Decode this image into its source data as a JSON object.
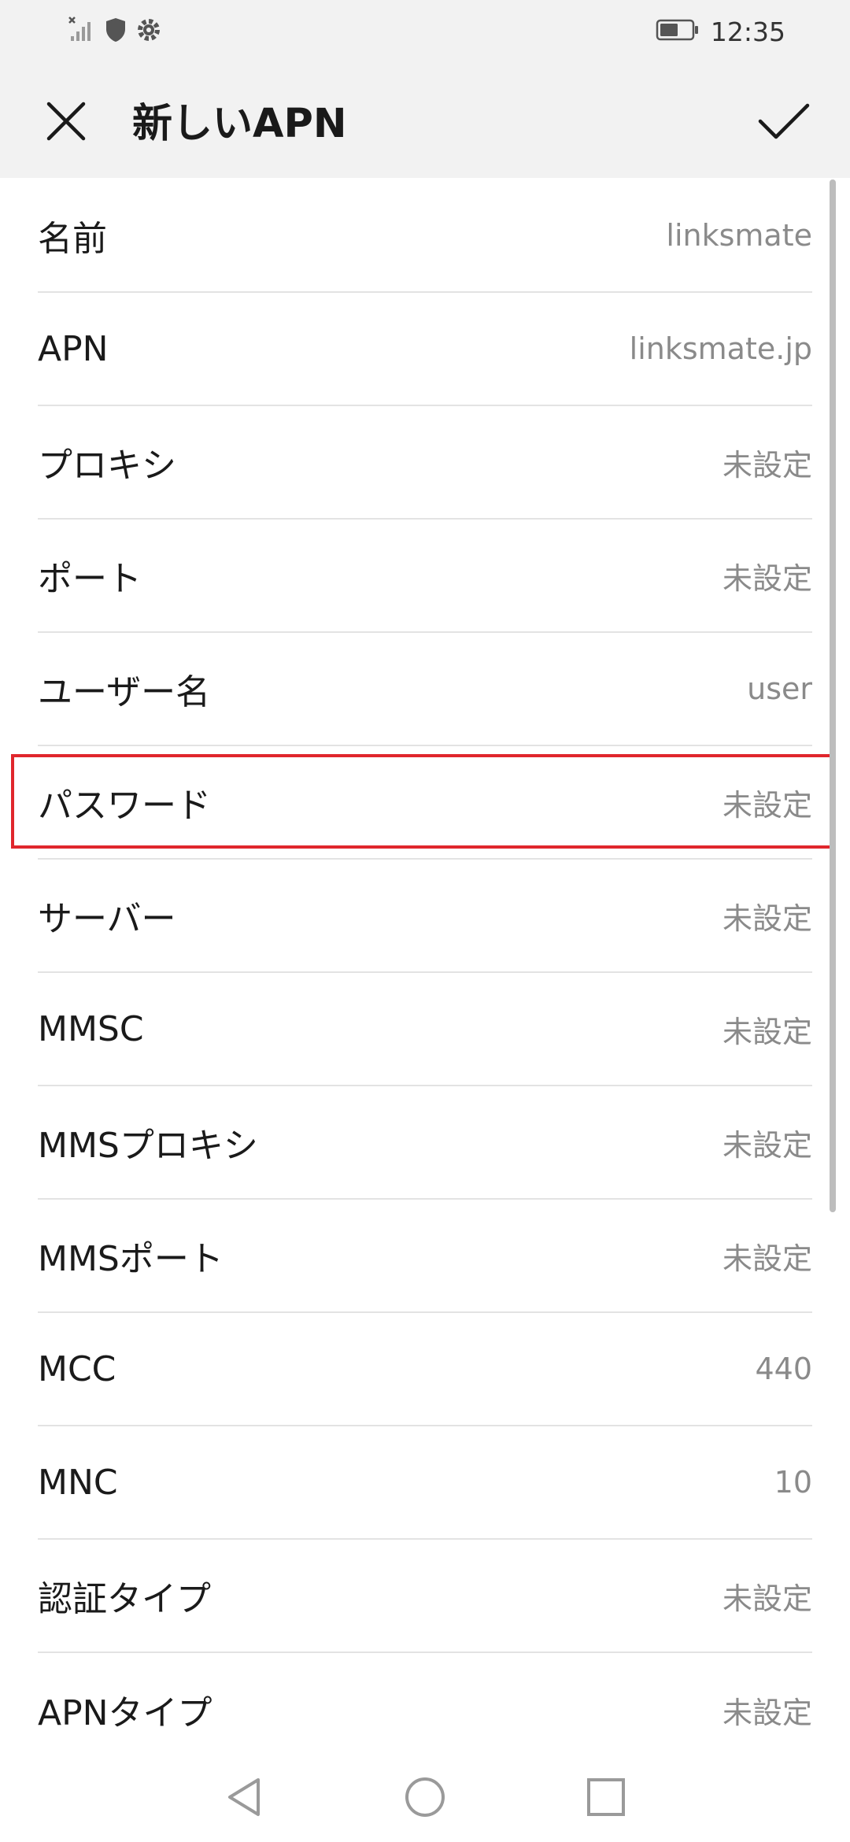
{
  "status_bar": {
    "time": "12:35",
    "icons": [
      "signal-off-icon",
      "shield-icon",
      "gear-icon",
      "battery-icon"
    ]
  },
  "app_bar": {
    "title": "新しいAPN",
    "close_icon": "close-icon",
    "confirm_icon": "check-icon"
  },
  "rows": [
    {
      "label": "名前",
      "value": "linksmate"
    },
    {
      "label": "APN",
      "value": "linksmate.jp"
    },
    {
      "label": "プロキシ",
      "value": "未設定"
    },
    {
      "label": "ポート",
      "value": "未設定"
    },
    {
      "label": "ユーザー名",
      "value": "user"
    },
    {
      "label": "パスワード",
      "value": "未設定"
    },
    {
      "label": "サーバー",
      "value": "未設定"
    },
    {
      "label": "MMSC",
      "value": "未設定"
    },
    {
      "label": "MMSプロキシ",
      "value": "未設定"
    },
    {
      "label": "MMSポート",
      "value": "未設定"
    },
    {
      "label": "MCC",
      "value": "440"
    },
    {
      "label": "MNC",
      "value": "10"
    },
    {
      "label": "認証タイプ",
      "value": "未設定"
    },
    {
      "label": "APNタイプ",
      "value": "未設定"
    }
  ],
  "colors": {
    "highlight_border": "#e0262c",
    "header_bg": "#f2f2f2",
    "value_text": "#8a8a8a"
  },
  "nav_bar": {
    "icons": [
      "back-icon",
      "home-icon",
      "recents-icon"
    ]
  }
}
